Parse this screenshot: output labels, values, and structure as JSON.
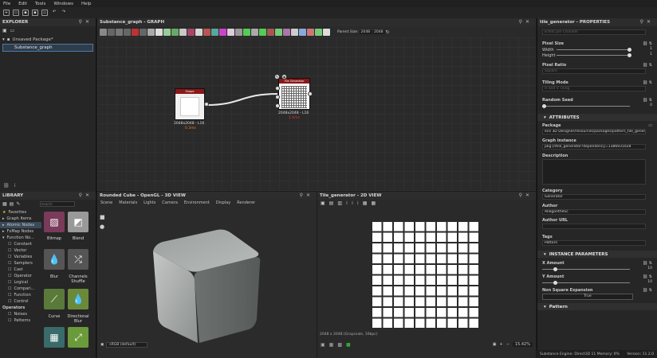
{
  "menu": [
    "File",
    "Edit",
    "Tools",
    "Windows",
    "Help"
  ],
  "explorer": {
    "title": "EXPLORER",
    "package": "Unsaved Package*",
    "graph": "Substance_graph"
  },
  "graph_panel": {
    "title": "Substance_graph - GRAPH",
    "parent_size_label": "Parent Size:",
    "parent_size_value": "2048",
    "size_value": "2048",
    "node_shape": {
      "header": "Shape",
      "caption": "2048x2048 - L16",
      "sub": "0.3ms"
    },
    "node_tile": {
      "header": "Tile Generator",
      "caption": "2048x2048 - L16",
      "sub": "1.6ms"
    }
  },
  "library": {
    "title": "LIBRARY",
    "search_placeholder": "Search",
    "categories": [
      "Favorites",
      "Graph Items",
      "Atomic Nodes",
      "FxMap Nodes",
      "Function No..."
    ],
    "functions": [
      "Constant",
      "Vector",
      "Variables",
      "Samplers",
      "Cast",
      "Operator",
      "Logical",
      "Compari...",
      "Function",
      "Control"
    ],
    "operators_label": "Operators",
    "more": [
      "Noises",
      "Patterns"
    ],
    "tiles": [
      "Bitmap",
      "Blend",
      "Blur",
      "Channels Shuffle",
      "Curve",
      "Directional Blur"
    ]
  },
  "view3d": {
    "title": "Rounded Cube - OpenGL - 3D VIEW",
    "menu": [
      "Scene",
      "Materials",
      "Lights",
      "Camera",
      "Environment",
      "Display",
      "Renderer"
    ],
    "colorspace": "sRGB (default)"
  },
  "view2d": {
    "title": "Tile_generator - 2D VIEW",
    "info": "2048 x 2048 (Grayscale, 16bpc)",
    "zoom": "15.42%"
  },
  "properties": {
    "title": "tile_generator - PROPERTIES",
    "output_field": "8 Bits per Channel",
    "pixel_size": {
      "label": "Pixel Size",
      "width_label": "Width",
      "width_value": "1",
      "height_label": "Height",
      "height_value": "1"
    },
    "pixel_ratio": {
      "label": "Pixel Ratio",
      "value": "Square"
    },
    "tiling_mode": {
      "label": "Tiling Mode",
      "value": "H and V Tiling"
    },
    "random_seed": {
      "label": "Random Seed",
      "value": "0"
    },
    "attributes_header": "ATTRIBUTES",
    "package": {
      "label": "Package",
      "value": "ece 3D Designer/resources/packages/pattern_tile_generator.sbs"
    },
    "graph_instance": {
      "label": "Graph instance",
      "value": "pkg:///tile_generator?dependency=1386931028"
    },
    "description_label": "Description",
    "category": {
      "label": "Category",
      "value": "Generator"
    },
    "author": {
      "label": "Author",
      "value": "Allegorithmic"
    },
    "author_url_label": "Author URL",
    "tags": {
      "label": "Tags",
      "value": "Pattern"
    },
    "instance_header": "INSTANCE PARAMETERS",
    "x_amount": {
      "label": "X Amount",
      "value": "10"
    },
    "y_amount": {
      "label": "Y Amount",
      "value": "10"
    },
    "non_square": {
      "label": "Non Square Expansion",
      "value": "True"
    },
    "pattern_header": "Pattern"
  },
  "status": "Substance Engine: Direct3D 11  Memory: 0%",
  "version": "Version: 11.2.0"
}
